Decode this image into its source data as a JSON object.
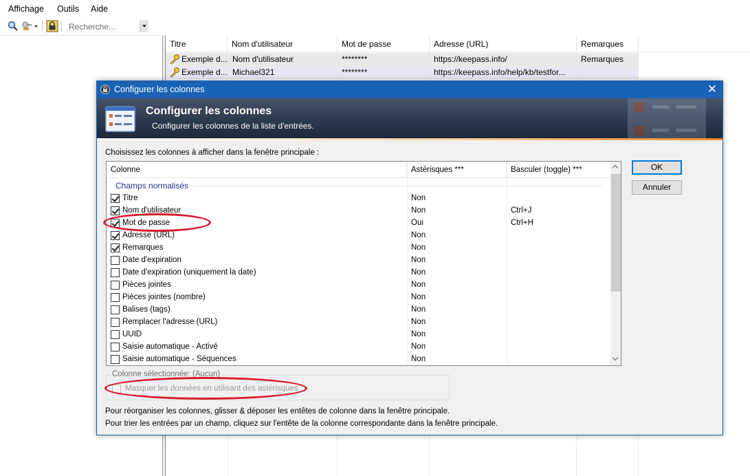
{
  "menu": [
    "Affichage",
    "Outils",
    "Aide"
  ],
  "toolbar": {
    "search_placeholder": "Recherche..."
  },
  "entries": {
    "columns": [
      "Titre",
      "Nom d'utilisateur",
      "Mot de passe",
      "Adresse (URL)",
      "Remarques"
    ],
    "rows": [
      {
        "title": "Exemple d...",
        "user": "Nom d'utilisateur",
        "password": "********",
        "url": "https://keepass.info/",
        "notes": "Remarques"
      },
      {
        "title": "Exemple d...",
        "user": "Michael321",
        "password": "********",
        "url": "https://keepass.info/help/kb/testfor...",
        "notes": ""
      }
    ]
  },
  "dialog": {
    "window_title": "Configurer les colonnes",
    "banner_title": "Configurer les colonnes",
    "banner_subtitle": "Configurer les colonnes de la liste d'entrées.",
    "instruction": "Choisissez les colonnes à afficher dans la fenêtre principale :",
    "list_headers": {
      "column": "Colonne",
      "asterisks": "Astérisques ***",
      "toggle": "Basculer (toggle) ***"
    },
    "group_label": "Champs normalisés",
    "fields": [
      {
        "name": "Titre",
        "checked": true,
        "asterisks": "Non",
        "toggle": ""
      },
      {
        "name": "Nom d'utilisateur",
        "checked": true,
        "asterisks": "Non",
        "toggle": "Ctrl+J"
      },
      {
        "name": "Mot de passe",
        "checked": true,
        "asterisks": "Oui",
        "toggle": "Ctrl+H"
      },
      {
        "name": "Adresse (URL)",
        "checked": true,
        "asterisks": "Non",
        "toggle": ""
      },
      {
        "name": "Remarques",
        "checked": true,
        "asterisks": "Non",
        "toggle": ""
      },
      {
        "name": "Date d'expiration",
        "checked": false,
        "asterisks": "Non",
        "toggle": ""
      },
      {
        "name": "Date d'expiration (uniquement la date)",
        "checked": false,
        "asterisks": "Non",
        "toggle": ""
      },
      {
        "name": "Pièces jointes",
        "checked": false,
        "asterisks": "Non",
        "toggle": ""
      },
      {
        "name": "Pièces jointes (nombre)",
        "checked": false,
        "asterisks": "Non",
        "toggle": ""
      },
      {
        "name": "Balises (tags)",
        "checked": false,
        "asterisks": "Non",
        "toggle": ""
      },
      {
        "name": "Remplacer l'adresse (URL)",
        "checked": false,
        "asterisks": "Non",
        "toggle": ""
      },
      {
        "name": "UUID",
        "checked": false,
        "asterisks": "Non",
        "toggle": ""
      },
      {
        "name": "Saisie automatique - Activé",
        "checked": false,
        "asterisks": "Non",
        "toggle": ""
      },
      {
        "name": "Saisie automatique - Séquences",
        "checked": false,
        "asterisks": "Non",
        "toggle": ""
      }
    ],
    "selected_column_label": "Colonne sélectionnée: (Aucun)",
    "mask_option_label": "Masquer les données en utilisant des astérisques",
    "hint_reorder": "Pour réorganiser les colonnes, glisser & déposer les entêtes de colonne dans la fenêtre principale.",
    "hint_sort": "Pour trier les entrées par un champ, cliquez sur l'entête de la colonne correspondante dans la fenêtre principale.",
    "ok_label": "OK",
    "cancel_label": "Annuler"
  },
  "colors": {
    "title_bar": "#1a63b4",
    "annotation": "#d9192b",
    "group_label": "#1e3287"
  },
  "icons": [
    "search-icon",
    "key-generator-icon",
    "lock-icon",
    "dropdown-arrow-icon",
    "key-icon",
    "keepass-icon",
    "columns-icon",
    "close-icon"
  ]
}
